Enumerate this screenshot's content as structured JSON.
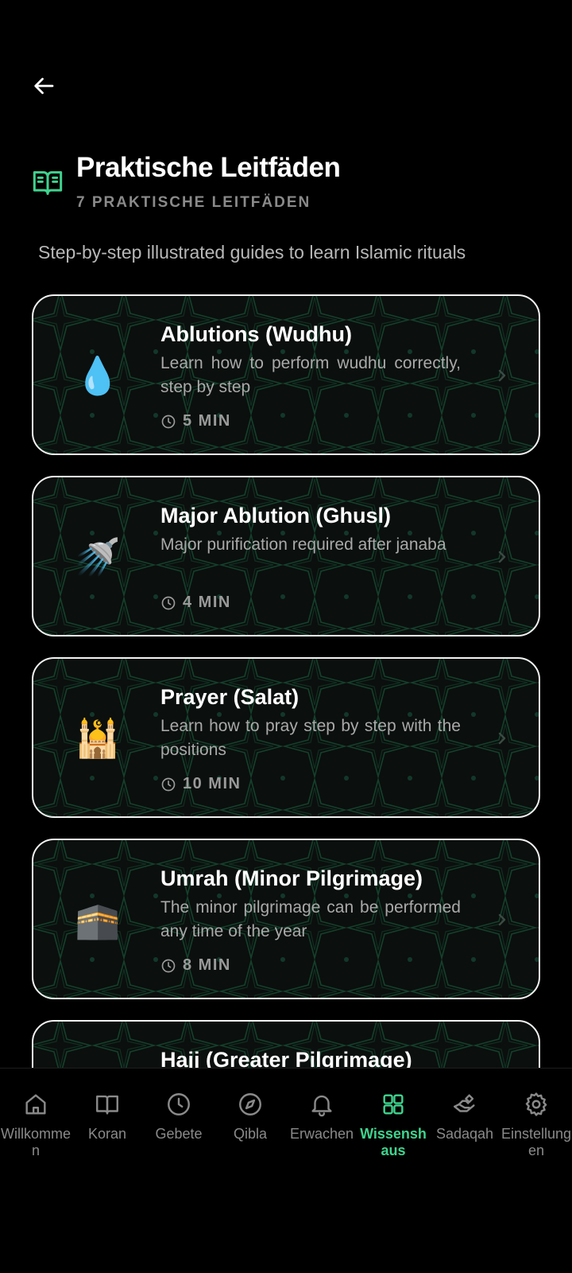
{
  "header": {
    "title": "Praktische Leitfäden",
    "subtitle": "7 PRAKTISCHE LEITFÄDEN",
    "description": "Step-by-step illustrated guides to learn Islamic rituals",
    "icon": "open-book-icon"
  },
  "guides": [
    {
      "emoji": "💧",
      "icon": "water-drop-icon",
      "title": "Ablutions (Wudhu)",
      "desc": "Learn how to perform wudhu correctly, step by step",
      "duration": "5 MIN"
    },
    {
      "emoji": "🚿",
      "icon": "shower-icon",
      "title": "Major Ablution (Ghusl)",
      "desc": "Major purification required after janaba",
      "duration": "4 MIN"
    },
    {
      "emoji": "🕌",
      "icon": "mosque-icon",
      "title": "Prayer (Salat)",
      "desc": "Learn how to pray step by step with the positions",
      "duration": "10 MIN"
    },
    {
      "emoji": "🕋",
      "icon": "kaaba-icon",
      "title": "Umrah (Minor Pilgrimage)",
      "desc": "The minor pilgrimage can be performed any time of the year",
      "duration": "8 MIN"
    },
    {
      "emoji": "",
      "icon": "",
      "title": "Hajj (Greater Pilgrimage)",
      "desc": "",
      "duration": ""
    }
  ],
  "nav": [
    {
      "label": "Willkommen",
      "icon": "home-icon",
      "active": false
    },
    {
      "label": "Koran",
      "icon": "book-icon",
      "active": false
    },
    {
      "label": "Gebete",
      "icon": "clock-icon",
      "active": false
    },
    {
      "label": "Qibla",
      "icon": "compass-icon",
      "active": false
    },
    {
      "label": "Erwachen",
      "icon": "bell-icon",
      "active": false
    },
    {
      "label": "Wissenshaus",
      "icon": "grid-icon",
      "active": true
    },
    {
      "label": "Sadaqah",
      "icon": "charity-hand-icon",
      "active": false
    },
    {
      "label": "Einstellungen",
      "icon": "gear-icon",
      "active": false
    }
  ],
  "colors": {
    "accent": "#3fd38e",
    "background": "#000000",
    "card_border": "#f2f2f2",
    "muted": "#8a8a8a"
  }
}
